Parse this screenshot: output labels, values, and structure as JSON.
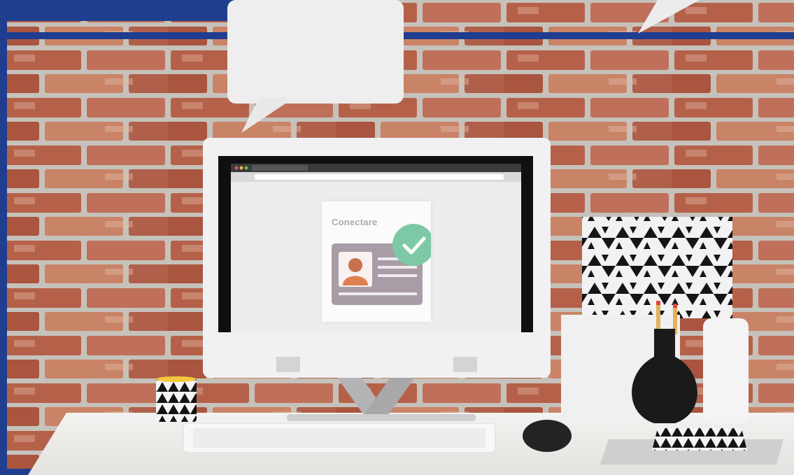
{
  "screen": {
    "login_card_title": "Conectare"
  },
  "colors": {
    "frame_blue": "#1f3e8f",
    "check_green": "#7dc9a6",
    "id_card": "#a89da6",
    "brick": "#b5614a",
    "mortar": "#c9c5bf"
  },
  "icons": {
    "check": "check-icon",
    "user": "user-avatar-icon"
  }
}
